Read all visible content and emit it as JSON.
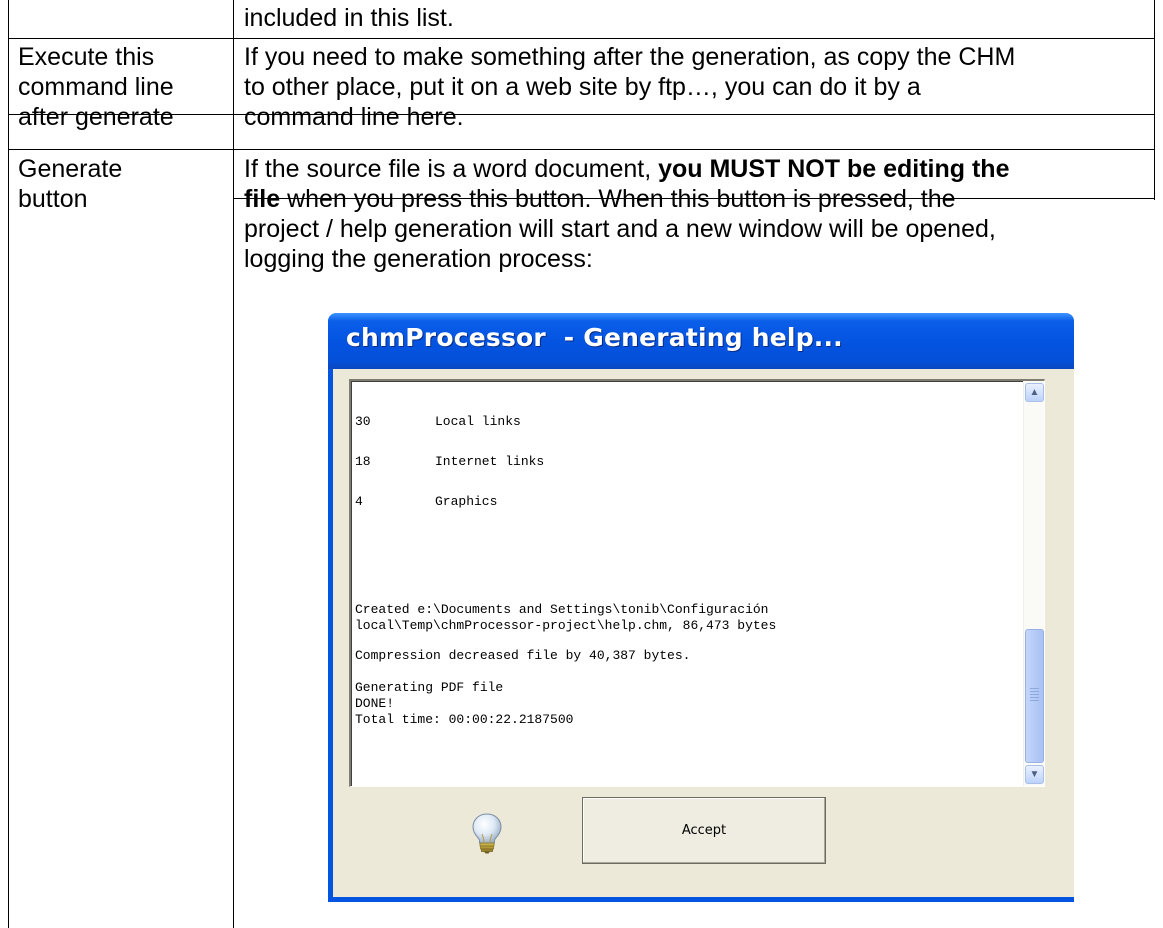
{
  "table": {
    "row_continued": {
      "description": "included in this list."
    },
    "row_execute": {
      "label": [
        "Execute this",
        "command line",
        "after generate"
      ],
      "description": [
        "If you need to make something after the generation, as copy the CHM",
        "to other place, put it on a web site by ftp…, you can do it by a",
        "command line here."
      ]
    },
    "row_generate": {
      "label": [
        "Generate",
        "button"
      ],
      "desc_line1_pre": "If the source file is a word document, ",
      "desc_line1_bold": "you MUST NOT be editing the",
      "desc_line2_bold": "file",
      "desc_line2_post": " when you press this button. When this button is pressed, the",
      "desc_line3": "project / help generation will start and a new window will be opened,",
      "desc_line4": "logging the generation process:"
    }
  },
  "window": {
    "title": "chmProcessor  - Generating help...",
    "log": {
      "stats": [
        {
          "count": "30",
          "label": "Local links"
        },
        {
          "count": "18",
          "label": "Internet links"
        },
        {
          "count": "4",
          "label": "Graphics"
        }
      ],
      "created_line1": "Created e:\\Documents and Settings\\tonib\\Configuración",
      "created_line2": "local\\Temp\\chmProcessor-project\\help.chm, 86,473 bytes",
      "compression": "Compression decreased file by 40,387 bytes.",
      "generating_pdf": "Generating PDF file",
      "done": "DONE!",
      "total_time": "Total time: 00:00:22.2187500"
    },
    "scroll_up_glyph": "▲",
    "scroll_down_glyph": "▼",
    "bulb_icon": "lightbulb-icon",
    "accept_label": "Accept"
  }
}
